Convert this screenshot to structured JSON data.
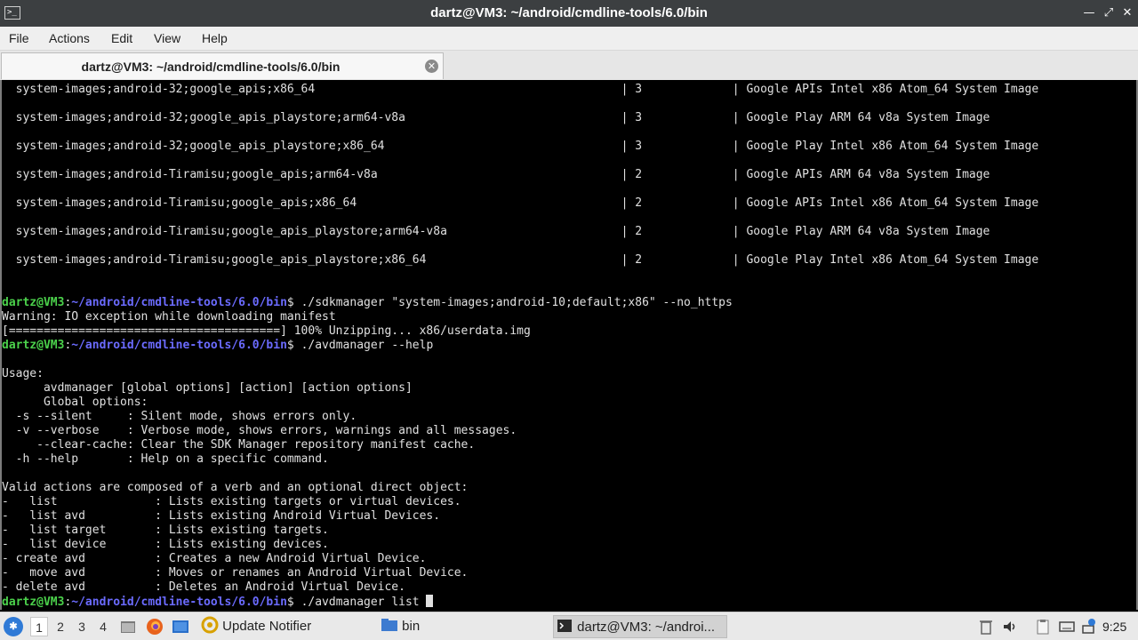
{
  "window": {
    "title": "dartz@VM3: ~/android/cmdline-tools/6.0/bin",
    "icon_text": ">_"
  },
  "menu": [
    "File",
    "Actions",
    "Edit",
    "View",
    "Help"
  ],
  "tab": {
    "label": "dartz@VM3: ~/android/cmdline-tools/6.0/bin"
  },
  "terminal": {
    "prompt_user": "dartz@VM3",
    "prompt_path": "~/android/cmdline-tools/6.0/bin",
    "lines": [
      "  system-images;android-32;google_apis;x86_64                                            | 3             | Google APIs Intel x86 Atom_64 System Image",
      "",
      "  system-images;android-32;google_apis_playstore;arm64-v8a                               | 3             | Google Play ARM 64 v8a System Image",
      "",
      "  system-images;android-32;google_apis_playstore;x86_64                                  | 3             | Google Play Intel x86 Atom_64 System Image",
      "",
      "  system-images;android-Tiramisu;google_apis;arm64-v8a                                   | 2             | Google APIs ARM 64 v8a System Image",
      "",
      "  system-images;android-Tiramisu;google_apis;x86_64                                      | 2             | Google APIs Intel x86 Atom_64 System Image",
      "",
      "  system-images;android-Tiramisu;google_apis_playstore;arm64-v8a                         | 2             | Google Play ARM 64 v8a System Image",
      "",
      "  system-images;android-Tiramisu;google_apis_playstore;x86_64                            | 2             | Google Play Intel x86 Atom_64 System Image",
      "",
      "",
      "$ ./sdkmanager \"system-images;android-10;default;x86\" --no_https",
      "Warning: IO exception while downloading manifest",
      "[=======================================] 100% Unzipping... x86/userdata.img",
      "$ ./avdmanager --help",
      "",
      "Usage:",
      "      avdmanager [global options] [action] [action options]",
      "      Global options:",
      "  -s --silent     : Silent mode, shows errors only.",
      "  -v --verbose    : Verbose mode, shows errors, warnings and all messages.",
      "     --clear-cache: Clear the SDK Manager repository manifest cache.",
      "  -h --help       : Help on a specific command.",
      "",
      "Valid actions are composed of a verb and an optional direct object:",
      "-   list              : Lists existing targets or virtual devices.",
      "-   list avd          : Lists existing Android Virtual Devices.",
      "-   list target       : Lists existing targets.",
      "-   list device       : Lists existing devices.",
      "- create avd          : Creates a new Android Virtual Device.",
      "-   move avd          : Moves or renames an Android Virtual Device.",
      "- delete avd          : Deletes an Android Virtual Device.",
      "$ ./avdmanager list "
    ]
  },
  "taskbar": {
    "workspaces": [
      "1",
      "2",
      "3",
      "4"
    ],
    "active_workspace": 0,
    "tasks": [
      {
        "label": "Update Notifier",
        "icon": "update-notifier-icon"
      },
      {
        "label": "bin",
        "icon": "folder-icon"
      },
      {
        "label": "dartz@VM3: ~/androi...",
        "icon": "terminal-icon"
      }
    ],
    "clock": "9:25"
  },
  "colors": {
    "prompt_user": "#4bd14b",
    "prompt_path": "#6b6bff",
    "terminal_bg": "#000000",
    "terminal_fg": "#e0e0e0"
  }
}
